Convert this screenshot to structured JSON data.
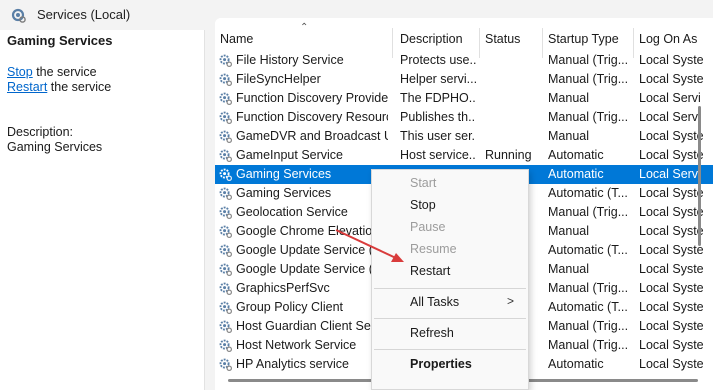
{
  "window": {
    "title": "Services (Local)"
  },
  "left_pane": {
    "service_name": "Gaming Services",
    "stop_link": "Stop",
    "stop_suffix": " the service",
    "restart_link": "Restart",
    "restart_suffix": " the service",
    "description_label": "Description:",
    "description_text": "Gaming Services"
  },
  "table": {
    "columns": [
      "Name",
      "Description",
      "Status",
      "Startup Type",
      "Log On As"
    ],
    "rows": [
      {
        "name": "File History Service",
        "description": "Protects use...",
        "status": "",
        "startup": "Manual (Trig...",
        "logon": "Local Syste"
      },
      {
        "name": "FileSyncHelper",
        "description": "Helper servi...",
        "status": "",
        "startup": "Manual (Trig...",
        "logon": "Local Syste"
      },
      {
        "name": "Function Discovery Provide...",
        "description": "The FDPHO...",
        "status": "",
        "startup": "Manual",
        "logon": "Local Servi"
      },
      {
        "name": "Function Discovery Resourc...",
        "description": "Publishes th...",
        "status": "",
        "startup": "Manual (Trig...",
        "logon": "Local Servi"
      },
      {
        "name": "GameDVR and Broadcast Us...",
        "description": "This user ser...",
        "status": "",
        "startup": "Manual",
        "logon": "Local Syste"
      },
      {
        "name": "GameInput Service",
        "description": "Host service...",
        "status": "Running",
        "startup": "Automatic",
        "logon": "Local Syste"
      },
      {
        "name": "Gaming Services",
        "description": "",
        "status": "",
        "startup": "Automatic",
        "logon": "Local Servi",
        "selected": true
      },
      {
        "name": "Gaming Services",
        "description": "",
        "status": "",
        "startup": "Automatic (T...",
        "logon": "Local Syste"
      },
      {
        "name": "Geolocation Service",
        "description": "",
        "status": "",
        "startup": "Manual (Trig...",
        "logon": "Local Syste"
      },
      {
        "name": "Google Chrome Elevation",
        "description": "",
        "status": "",
        "startup": "Manual",
        "logon": "Local Syste"
      },
      {
        "name": "Google Update Service (gu",
        "description": "",
        "status": "",
        "startup": "Automatic (T...",
        "logon": "Local Syste"
      },
      {
        "name": "Google Update Service (gu",
        "description": "",
        "status": "",
        "startup": "Manual",
        "logon": "Local Syste"
      },
      {
        "name": "GraphicsPerfSvc",
        "description": "",
        "status": "",
        "startup": "Manual (Trig...",
        "logon": "Local Syste"
      },
      {
        "name": "Group Policy Client",
        "description": "",
        "status": "",
        "startup": "Automatic (T...",
        "logon": "Local Syste"
      },
      {
        "name": "Host Guardian Client Serv",
        "description": "",
        "status": "",
        "startup": "Manual (Trig...",
        "logon": "Local Syste"
      },
      {
        "name": "Host Network Service",
        "description": "",
        "status": "",
        "startup": "Manual (Trig...",
        "logon": "Local Syste"
      },
      {
        "name": "HP Analytics service",
        "description": "",
        "status": "",
        "startup": "Automatic",
        "logon": "Local Syste"
      }
    ]
  },
  "context_menu": {
    "items": [
      {
        "label": "Start",
        "enabled": false
      },
      {
        "label": "Stop",
        "enabled": true
      },
      {
        "label": "Pause",
        "enabled": false
      },
      {
        "label": "Resume",
        "enabled": false
      },
      {
        "label": "Restart",
        "enabled": true
      },
      {
        "label": "All Tasks",
        "enabled": true,
        "submenu": true
      },
      {
        "label": "Refresh",
        "enabled": true
      },
      {
        "label": "Properties",
        "enabled": true,
        "bold": true
      }
    ],
    "submenu_arrow": ">"
  },
  "colors": {
    "selection": "#0078d7",
    "link": "#0066cc",
    "annotation_arrow": "#d93c3c"
  }
}
